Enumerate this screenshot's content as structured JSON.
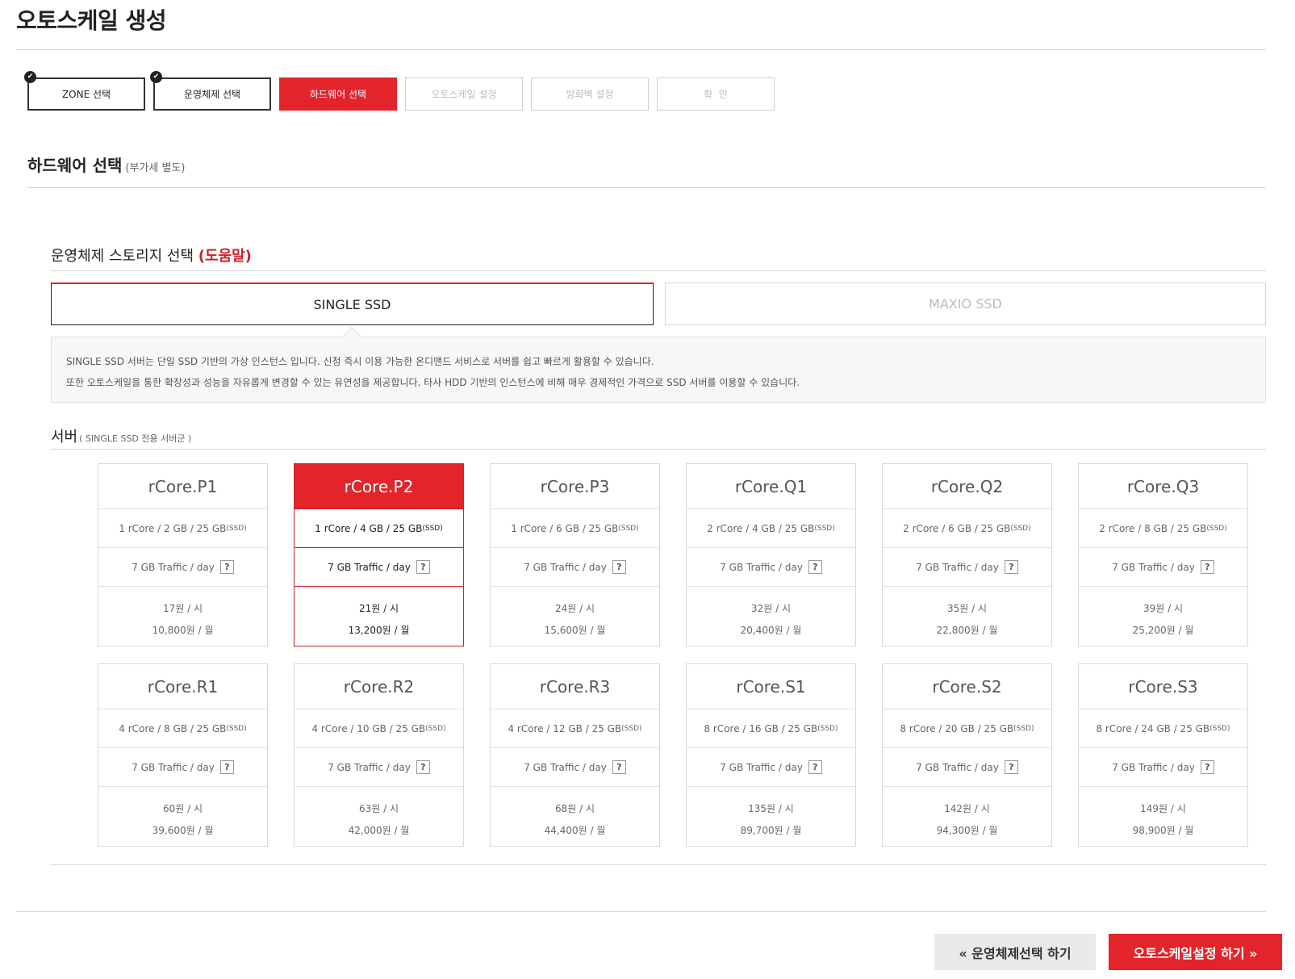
{
  "page": {
    "title": "오토스케일 생성"
  },
  "steps": [
    {
      "label": "ZONE 선택",
      "state": "done"
    },
    {
      "label": "운영체제 선택",
      "state": "done"
    },
    {
      "label": "하드웨어 선택",
      "state": "active"
    },
    {
      "label": "오토스케일 설정",
      "state": "pending"
    },
    {
      "label": "방화벽 설정",
      "state": "pending"
    },
    {
      "label": "확  인",
      "state": "pending"
    }
  ],
  "hardware": {
    "title": "하드웨어 선택",
    "note": "(부가세 별도)"
  },
  "storage": {
    "title": "운영체제 스토리지 선택",
    "help": "(도움말)",
    "tabs": [
      {
        "label": "SINGLE SSD",
        "selected": true
      },
      {
        "label": "MAXIO SSD",
        "selected": false
      }
    ],
    "description": [
      "SINGLE SSD 서버는 단일 SSD 기반의 가상 인스턴스 입니다. 신청 즉시 이용 가능한 온디맨드 서비스로 서버를 쉽고 빠르게 활용할 수 있습니다.",
      "또한 오토스케일을 통한 확장성과 성능을 자유롭게 변경할 수 있는 유연성을 제공합니다. 타사 HDD 기반의 인스턴스에 비해 매우 경제적인 가격으로 SSD 서버를 이용할 수 있습니다."
    ]
  },
  "servers": {
    "title": "서버",
    "note": "( SINGLE SSD 전용 서버군 )",
    "traffic_label": "7 GB Traffic / day",
    "help_icon": "?",
    "ssd_tag": "(SSD)",
    "items": [
      {
        "name": "rCore.P1",
        "spec": "1 rCore / 2 GB / 25 GB",
        "hourly": "17원 / 시",
        "monthly": "10,800원 / 월"
      },
      {
        "name": "rCore.P2",
        "spec": "1 rCore / 4 GB / 25 GB",
        "hourly": "21원 / 시",
        "monthly": "13,200원 / 월",
        "selected": true
      },
      {
        "name": "rCore.P3",
        "spec": "1 rCore / 6 GB / 25 GB",
        "hourly": "24원 / 시",
        "monthly": "15,600원 / 월"
      },
      {
        "name": "rCore.Q1",
        "spec": "2 rCore / 4 GB / 25 GB",
        "hourly": "32원 / 시",
        "monthly": "20,400원 / 월"
      },
      {
        "name": "rCore.Q2",
        "spec": "2 rCore / 6 GB / 25 GB",
        "hourly": "35원 / 시",
        "monthly": "22,800원 / 월"
      },
      {
        "name": "rCore.Q3",
        "spec": "2 rCore / 8 GB / 25 GB",
        "hourly": "39원 / 시",
        "monthly": "25,200원 / 월"
      },
      {
        "name": "rCore.R1",
        "spec": "4 rCore / 8 GB / 25 GB",
        "hourly": "60원 / 시",
        "monthly": "39,600원 / 월"
      },
      {
        "name": "rCore.R2",
        "spec": "4 rCore / 10 GB / 25 GB",
        "hourly": "63원 / 시",
        "monthly": "42,000원 / 월"
      },
      {
        "name": "rCore.R3",
        "spec": "4 rCore / 12 GB / 25 GB",
        "hourly": "68원 / 시",
        "monthly": "44,400원 / 월"
      },
      {
        "name": "rCore.S1",
        "spec": "8 rCore / 16 GB / 25 GB",
        "hourly": "135원 / 시",
        "monthly": "89,700원 / 월"
      },
      {
        "name": "rCore.S2",
        "spec": "8 rCore / 20 GB / 25 GB",
        "hourly": "142원 / 시",
        "monthly": "94,300원 / 월"
      },
      {
        "name": "rCore.S3",
        "spec": "8 rCore / 24 GB / 25 GB",
        "hourly": "149원 / 시",
        "monthly": "98,900원 / 월"
      }
    ]
  },
  "footer": {
    "prev_label": "« 운영체제선택 하기",
    "next_label": "오토스케일설정 하기 »"
  },
  "colors": {
    "accent": "#e3242b",
    "help_link": "#c8232c",
    "border": "#d9d9d9"
  }
}
